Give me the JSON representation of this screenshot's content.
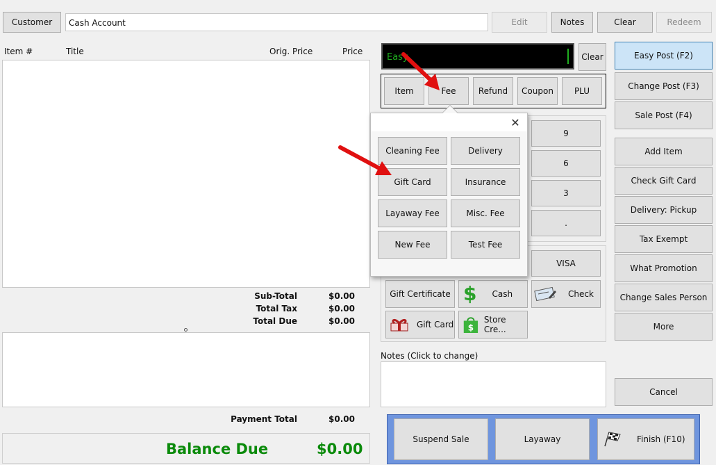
{
  "top": {
    "customer_label": "Customer",
    "customer_value": "Cash Account",
    "edit_label": "Edit",
    "notes_label": "Notes",
    "clear_label": "Clear",
    "redeem_label": "Redeem"
  },
  "items_table": {
    "columns": [
      "Item #",
      "Title",
      "Orig. Price",
      "Price"
    ]
  },
  "totals": {
    "subtotal_label": "Sub-Total",
    "subtotal_value": "$0.00",
    "tax_label": "Total Tax",
    "tax_value": "$0.00",
    "due_label": "Total Due",
    "due_value": "$0.00",
    "payment_label": "Payment Total",
    "payment_value": "$0.00",
    "balance_label": "Balance Due",
    "balance_value": "$0.00"
  },
  "entry": {
    "text": "Easy",
    "clear_label": "Clear"
  },
  "modes": [
    "Item",
    "Fee",
    "Refund",
    "Coupon",
    "PLU"
  ],
  "keypad": [
    "9",
    "6",
    "3",
    "."
  ],
  "fee_popup": {
    "close_glyph": "✕",
    "items": [
      "Cleaning Fee",
      "Delivery",
      "Gift Card",
      "Insurance",
      "Layaway Fee",
      "Misc. Fee",
      "New Fee",
      "Test Fee"
    ]
  },
  "tenders": {
    "visa": "VISA",
    "gift_certificate": "Gift Certificate",
    "cash": "Cash",
    "check": "Check",
    "gift_card": "Gift Card",
    "store_credit": "Store Cre..."
  },
  "notes": {
    "label": "Notes (Click to change)"
  },
  "right_actions": {
    "easy_post": "Easy Post (F2)",
    "change_post": "Change Post (F3)",
    "sale_post": "Sale Post (F4)",
    "add_item": "Add Item",
    "check_gift_card": "Check Gift Card",
    "delivery_pickup": "Delivery: Pickup",
    "tax_exempt": "Tax Exempt",
    "what_promotion": "What Promotion",
    "change_sales_person": "Change Sales Person",
    "more": "More",
    "cancel": "Cancel"
  },
  "bottom_actions": {
    "suspend": "Suspend Sale",
    "layaway": "Layaway",
    "finish": "Finish (F10)"
  },
  "colors": {
    "balance_green": "#0a8a0a",
    "entry_bg": "#000000",
    "primary_blue": "#cce4f7",
    "bottom_bar": "#6f95de",
    "arrow_red": "#e01010"
  }
}
